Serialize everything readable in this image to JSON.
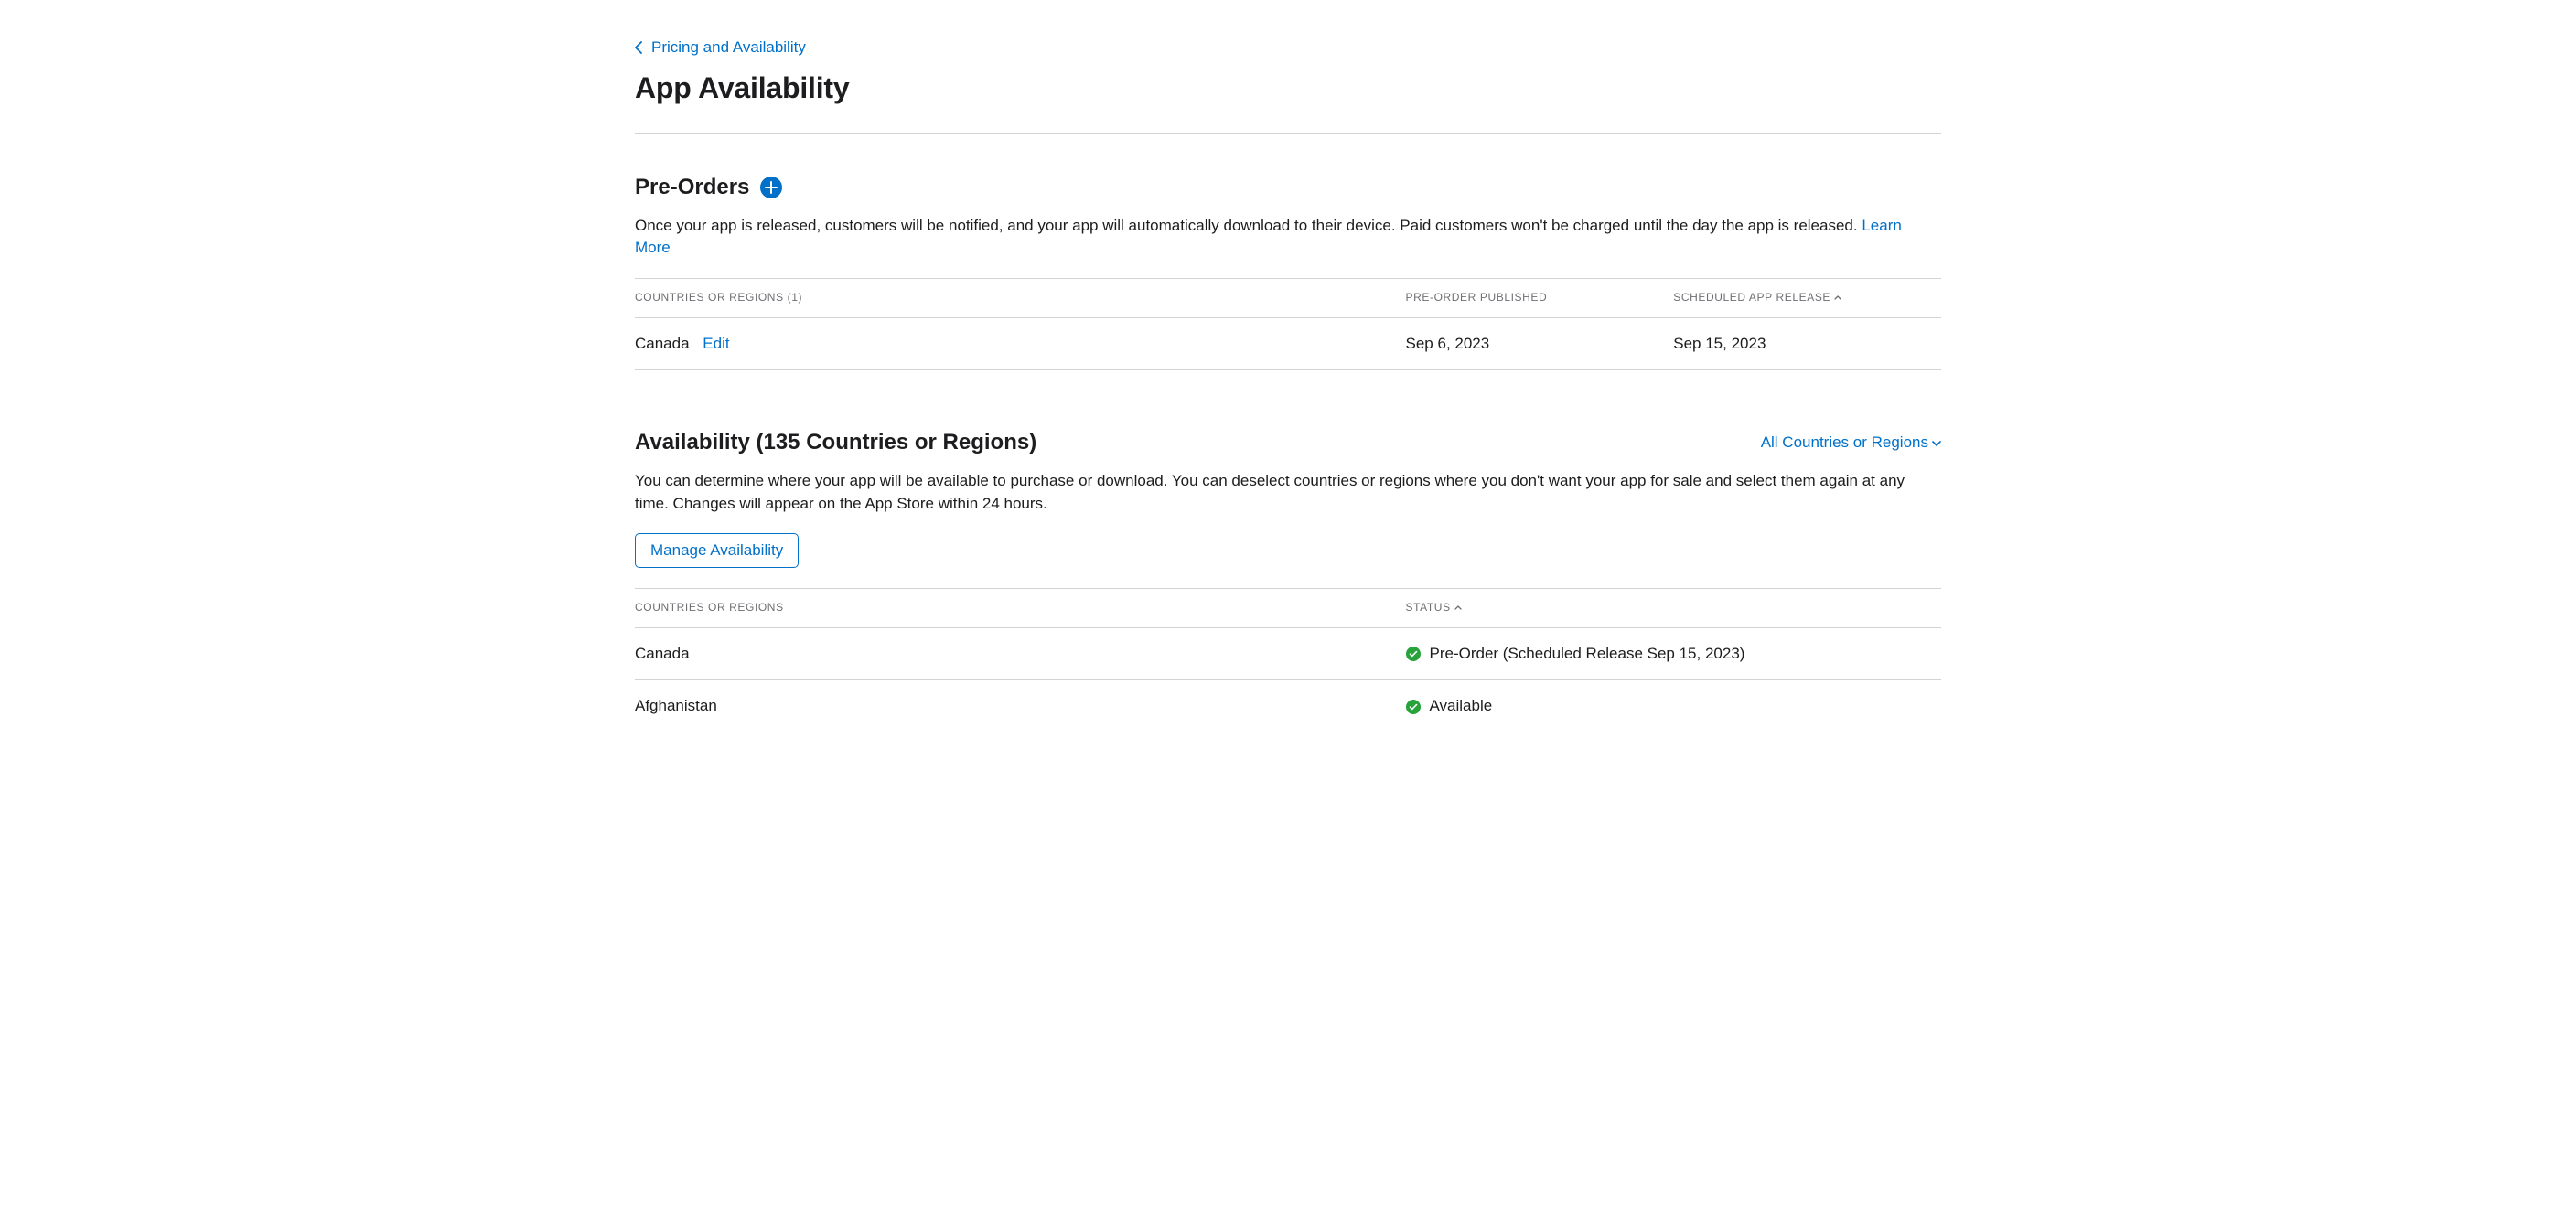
{
  "breadcrumb": {
    "label": "Pricing and Availability"
  },
  "pageTitle": "App Availability",
  "preOrders": {
    "heading": "Pre-Orders",
    "helptext": "Once your app is released, customers will be notified, and your app will automatically download to their device. Paid customers won't be charged until the day the app is released. ",
    "learnMore": "Learn More",
    "columns": {
      "countries": "Countries or Regions (1)",
      "published": "Pre-Order Published",
      "release": "Scheduled App Release"
    },
    "rows": [
      {
        "country": "Canada",
        "editLabel": "Edit",
        "published": "Sep 6, 2023",
        "release": "Sep 15, 2023"
      }
    ]
  },
  "availability": {
    "heading": "Availability (135 Countries or Regions)",
    "filterLabel": "All Countries or Regions",
    "helptext": "You can determine where your app will be available to purchase or download. You can deselect countries or regions where you don't want your app for sale and select them again at any time. Changes will appear on the App Store within 24 hours.",
    "manageButton": "Manage Availability",
    "columns": {
      "countries": "Countries or Regions",
      "status": "Status"
    },
    "rows": [
      {
        "country": "Canada",
        "status": "Pre-Order (Scheduled Release Sep 15, 2023)"
      },
      {
        "country": "Afghanistan",
        "status": "Available"
      }
    ]
  }
}
